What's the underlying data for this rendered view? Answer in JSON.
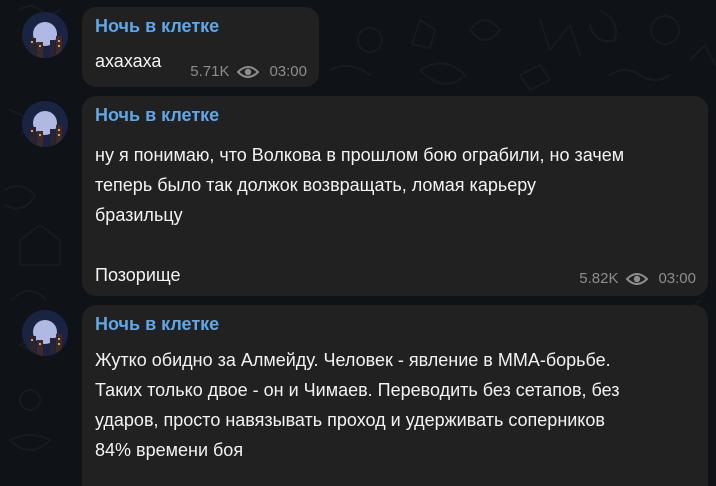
{
  "messages": [
    {
      "sender": "Ночь в клетке",
      "lines": [
        "ахахаха"
      ],
      "views": "5.71K",
      "time": "03:00"
    },
    {
      "sender": "Ночь в клетке",
      "lines": [
        "ну я понимаю, что Волкова в прошлом бою ограбили, но зачем",
        "теперь было так должок возвращать, ломая карьеру",
        "бразильцу",
        "",
        "Позорище"
      ],
      "views": "5.82K",
      "time": "03:00"
    },
    {
      "sender": "Ночь в клетке",
      "lines": [
        "Жутко обидно за Алмейду. Человек - явление в ММА-борьбе.",
        "Таких только двое - он и Чимаев. Переводить без сетапов, без",
        "ударов, просто навязывать проход и удерживать соперников",
        "84% времени боя"
      ]
    }
  ],
  "icons": {
    "views": "eye-icon",
    "avatar": "channel-avatar-night-city"
  },
  "colors": {
    "background": "#0f1216",
    "bubble": "#212121",
    "sender": "#5fa7e8",
    "text": "#f3f3f3",
    "meta": "#8d8d8d"
  }
}
